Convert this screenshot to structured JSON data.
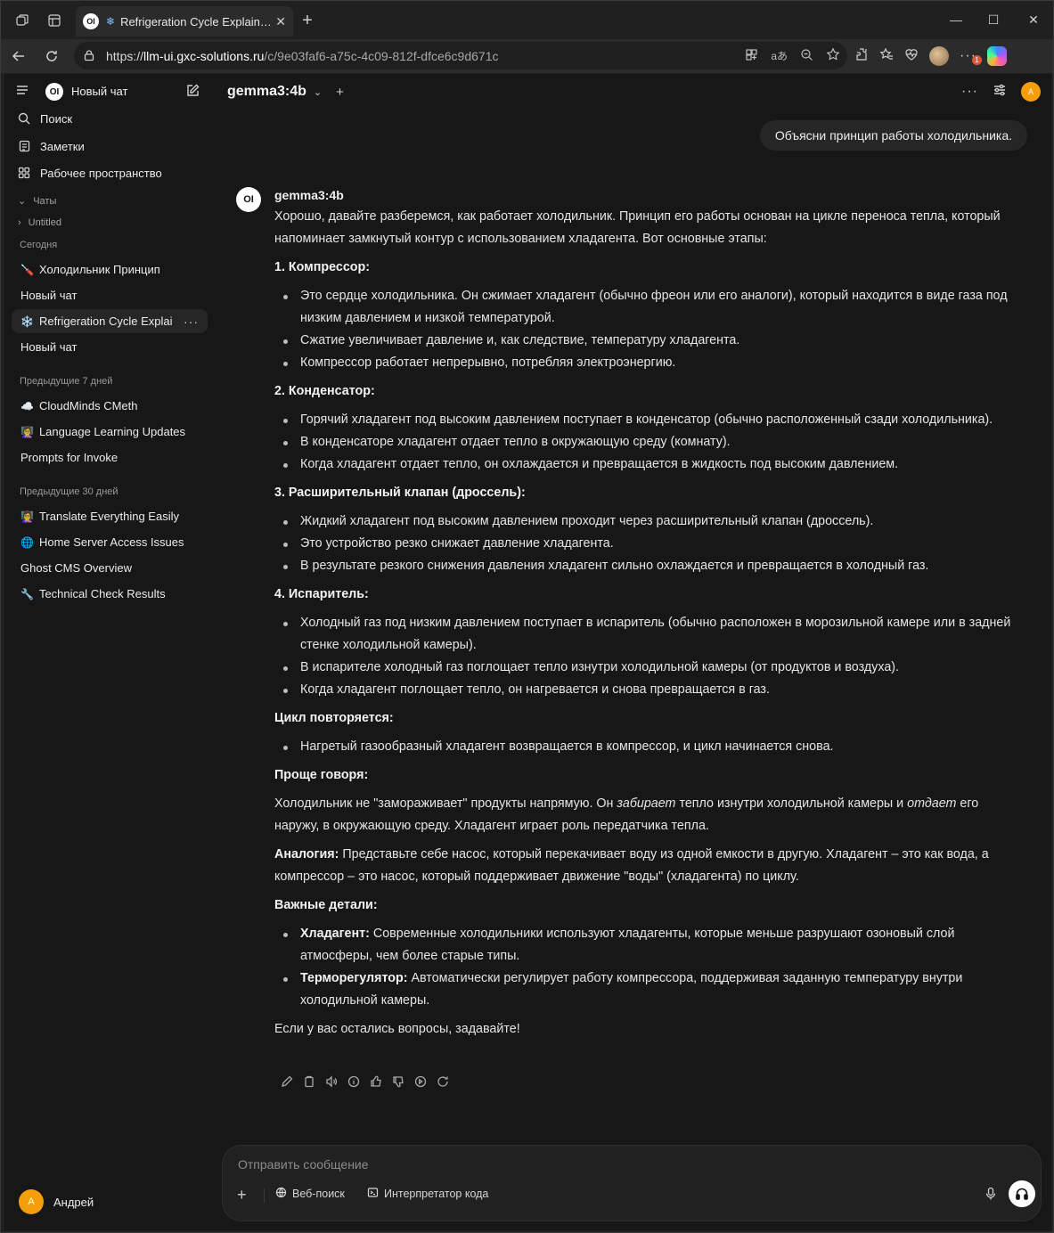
{
  "browser": {
    "tab_title": "Refrigeration Cycle Explain…",
    "url_scheme": "https://",
    "url_host": "llm-ui.gxc-solutions.ru",
    "url_path": "/c/9e03faf6-a75c-4c09-812f-dfce6c9d671c",
    "extension_badge": "1"
  },
  "sidebar": {
    "logo_text": "OI",
    "new_chat": "Новый чат",
    "nav": [
      {
        "label": "Поиск",
        "icon": "search-icon"
      },
      {
        "label": "Заметки",
        "icon": "notes-icon"
      },
      {
        "label": "Рабочее пространство",
        "icon": "workspace-icon"
      }
    ],
    "folders_label": "Чаты",
    "folder_item": "Untitled",
    "groups": [
      {
        "label": "Сегодня",
        "chats": [
          {
            "emoji": "🪛",
            "title": "Холодильник Принцип"
          },
          {
            "emoji": "",
            "title": "Новый чат"
          },
          {
            "emoji": "❄️",
            "title": "Refrigeration Cycle Explai"
          },
          {
            "emoji": "",
            "title": "Новый чат"
          }
        ]
      },
      {
        "label": "Предыдущие 7 дней",
        "chats": [
          {
            "emoji": "☁️",
            "title": "CloudMinds CMeth"
          },
          {
            "emoji": "👩‍🏫",
            "title": "Language Learning Updates"
          },
          {
            "emoji": "",
            "title": "Prompts for Invoke"
          }
        ]
      },
      {
        "label": "Предыдущие 30 дней",
        "chats": [
          {
            "emoji": "👩‍🏫",
            "title": "Translate Everything Easily"
          },
          {
            "emoji": "🌐",
            "title": "Home Server Access Issues"
          },
          {
            "emoji": "",
            "title": "Ghost CMS Overview"
          },
          {
            "emoji": "🔧",
            "title": "Technical Check Results"
          }
        ]
      }
    ],
    "user_initial": "A",
    "user_name": "Андрей"
  },
  "header": {
    "model": "gemma3:4b",
    "avatar_initial": "A"
  },
  "conversation": {
    "user_message": "Объясни принцип работы холодильника.",
    "assistant_name": "gemma3:4b",
    "assistant_logo": "OI",
    "intro": "Хорошо, давайте разберемся, как работает холодильник. Принцип его работы основан на цикле переноса тепла, который напоминает замкнутый контур с использованием хладагента. Вот основные этапы:",
    "sections": [
      {
        "heading": "1. Компрессор:",
        "items": [
          "Это сердце холодильника. Он сжимает хладагент (обычно фреон или его аналоги), который находится в виде газа под низким давлением и низкой температурой.",
          "Сжатие увеличивает давление и, как следствие, температуру хладагента.",
          "Компрессор работает непрерывно, потребляя электроэнергию."
        ]
      },
      {
        "heading": "2. Конденсатор:",
        "items": [
          "Горячий хладагент под высоким давлением поступает в конденсатор (обычно расположенный сзади холодильника).",
          "В конденсаторе хладагент отдает тепло в окружающую среду (комнату).",
          "Когда хладагент отдает тепло, он охлаждается и превращается в жидкость под высоким давлением."
        ]
      },
      {
        "heading": "3. Расширительный клапан (дроссель):",
        "items": [
          "Жидкий хладагент под высоким давлением проходит через расширительный клапан (дроссель).",
          "Это устройство резко снижает давление хладагента.",
          "В результате резкого снижения давления хладагент сильно охлаждается и превращается в холодный газ."
        ]
      },
      {
        "heading": "4. Испаритель:",
        "items": [
          "Холодный газ под низким давлением поступает в испаритель (обычно расположен в морозильной камере или в задней стенке холодильной камеры).",
          "В испарителе холодный газ поглощает тепло изнутри холодильной камеры (от продуктов и воздуха).",
          "Когда хладагент поглощает тепло, он нагревается и снова превращается в газ."
        ]
      },
      {
        "heading": "Цикл повторяется:",
        "items": [
          "Нагретый газообразный хладагент возвращается в компрессор, и цикл начинается снова."
        ]
      }
    ],
    "simpler_heading": "Проще говоря:",
    "simpler": {
      "p1": "Холодильник не \"замораживает\" продукты напрямую. Он ",
      "em1": "забирает",
      "p2": " тепло изнутри холодильной камеры и ",
      "em2": "отдает",
      "p3": " его наружу, в окружающую среду. Хладагент играет роль передатчика тепла."
    },
    "analogy_label": "Аналогия:",
    "analogy_text": " Представьте себе насос, который перекачивает воду из одной емкости в другую. Хладагент – это как вода, а компрессор – это насос, который поддерживает движение \"воды\" (хладагента) по циклу.",
    "details_heading": "Важные детали:",
    "details": [
      {
        "label": "Хладагент:",
        "text": " Современные холодильники используют хладагенты, которые меньше разрушают озоновый слой атмосферы, чем более старые типы."
      },
      {
        "label": "Терморегулятор:",
        "text": " Автоматически регулирует работу компрессора, поддерживая заданную температуру внутри холодильной камеры."
      }
    ],
    "closing": "Если у вас остались вопросы, задавайте!"
  },
  "composer": {
    "placeholder": "Отправить сообщение",
    "web_search": "Веб-поиск",
    "code_interpreter": "Интерпретатор кода"
  },
  "colors": {
    "background": "#171717",
    "accent_avatar": "#f59e0b",
    "active_chat": "#262626"
  }
}
